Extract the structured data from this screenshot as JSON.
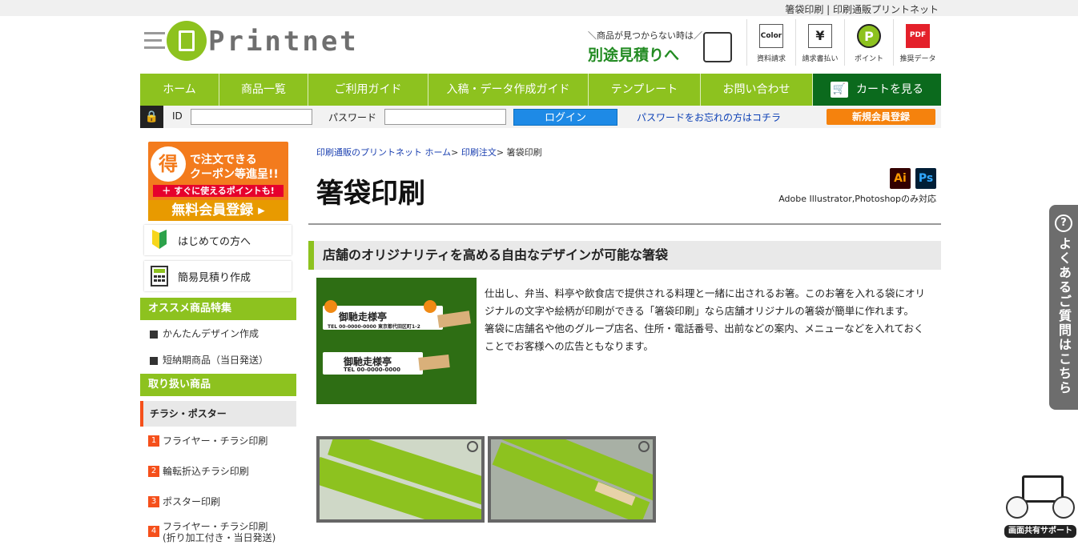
{
  "top_bar": {
    "text": "箸袋印刷 | 印刷通販プリントネット"
  },
  "logo": {
    "text": "Printnet",
    "color": "#8dc21f"
  },
  "estimate": {
    "sub": "＼商品が見つからない時は／",
    "main": "別途見積りへ"
  },
  "header_icons": [
    {
      "icon": "catalog-icon",
      "glyph": "Color",
      "label": "資料請求"
    },
    {
      "icon": "invoice-icon",
      "glyph": "¥",
      "label": "請求書払い"
    },
    {
      "icon": "point-icon",
      "glyph": "P",
      "label": "ポイント"
    },
    {
      "icon": "pdf-icon",
      "glyph": "PDF",
      "label": "推奨データ"
    }
  ],
  "nav": {
    "items": [
      "ホーム",
      "商品一覧",
      "ご利用ガイド",
      "入稿・データ作成ガイド",
      "テンプレート",
      "お問い合わせ"
    ],
    "cart": "カートを見る"
  },
  "login": {
    "id_label": "ID",
    "password_label": "パスワード",
    "login_button": "ログイン",
    "forgot": "パスワードをお忘れの方はコチラ",
    "register": "新規会員登録"
  },
  "sidebar": {
    "banner": {
      "toku": "得",
      "line1": "で注文できる",
      "line2": "クーポン等進呈!!",
      "line3": "＋ すぐに使えるポイントも!",
      "line4": "無料会員登録 ▸"
    },
    "boxes": [
      "はじめての方へ",
      "簡易見積り作成"
    ],
    "featured_heading": "オススメ商品特集",
    "featured_links": [
      "かんたんデザイン作成",
      "短納期商品（当日発送）"
    ],
    "products_heading": "取り扱い商品",
    "category": "チラシ・ポスター",
    "category_items": [
      {
        "num": "1",
        "label": "フライヤー・チラシ印刷"
      },
      {
        "num": "2",
        "label": "輪転折込チラシ印刷"
      },
      {
        "num": "3",
        "label": "ポスター印刷"
      },
      {
        "num": "4",
        "label": "フライヤー・チラシ印刷",
        "label2": "(折り加工付き・当日発送)"
      }
    ]
  },
  "main": {
    "breadcrumb": {
      "home": "印刷通販のプリントネット ホーム",
      "parent": "印刷注文",
      "current": "箸袋印刷",
      "sep": ">"
    },
    "title": "箸袋印刷",
    "adobe": {
      "ai": "Ai",
      "ps": "Ps",
      "text": "Adobe Illustrator,Photoshopのみ対応"
    },
    "section_heading": "店舗のオリジナリティを高める自由なデザインが可能な箸袋",
    "product_image": {
      "shop_name_1": "御馳走様亭",
      "tel_1": "TEL 00-0000-0000",
      "address_1": "東京都代田区町1-2",
      "shop_name_2": "御馳走様亭",
      "tel_2": "TEL 00-0000-0000"
    },
    "description": [
      "仕出し、弁当、料亭や飲食店で提供される料理と一緒に出されるお箸。このお箸を入れる袋にオリジナルの文字や絵柄が印刷ができる「箸袋印刷」なら店舗オリジナルの箸袋が簡単に作れます。",
      "箸袋に店舗名や他のグループ店名、住所・電話番号、出前などの案内、メニューなどを入れておくことでお客様への広告ともなります。"
    ]
  },
  "faq_tab": {
    "icon": "question-icon",
    "glyph": "?",
    "text": "よくあるご質問はこちら"
  },
  "screen_share": {
    "label": "画面共有サポート"
  }
}
